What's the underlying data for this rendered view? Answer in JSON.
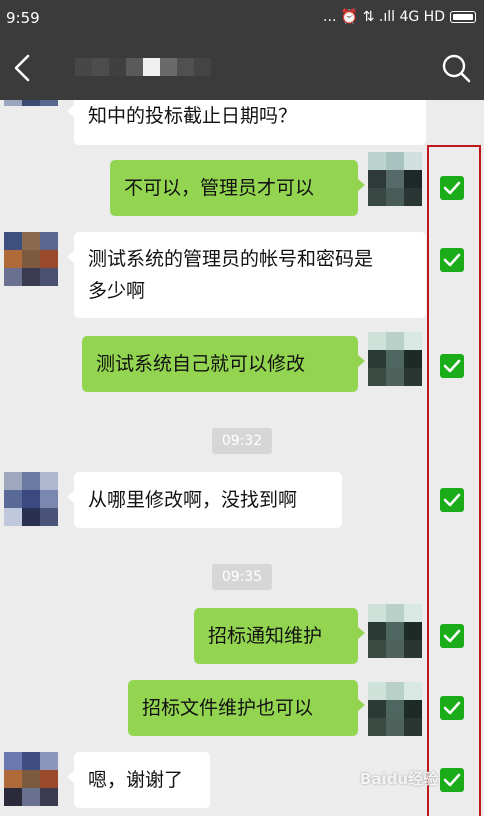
{
  "status_bar": {
    "time": "9:59",
    "right_text": "... ⏰ ⇅ .ıll 4G HD"
  },
  "nav": {
    "back_icon": "back-arrow-icon",
    "search_icon": "search-icon"
  },
  "messages": [
    {
      "side": "in",
      "text": "知中的投标截止日期吗？"
    },
    {
      "side": "out",
      "text": "不可以，管理员才可以"
    },
    {
      "side": "in",
      "text_line1": "测试系统的管理员的帐号和密码是",
      "text_line2": "多少啊"
    },
    {
      "side": "out",
      "text": "测试系统自己就可以修改"
    },
    {
      "side": "time",
      "text": "09:32"
    },
    {
      "side": "in",
      "text": "从哪里修改啊，没找到啊"
    },
    {
      "side": "time",
      "text": "09:35"
    },
    {
      "side": "out",
      "text": "招标通知维护"
    },
    {
      "side": "out",
      "text": "招标文件维护也可以"
    },
    {
      "side": "in",
      "text": "嗯，谢谢了"
    }
  ],
  "watermark": "Baidu经验",
  "colors": {
    "header_bg": "#3b3b3b",
    "chat_bg": "#ececec",
    "outgoing_bubble": "#93d551",
    "incoming_bubble": "#ffffff",
    "checkbox": "#1aad19",
    "highlight_border": "#c0161c"
  }
}
